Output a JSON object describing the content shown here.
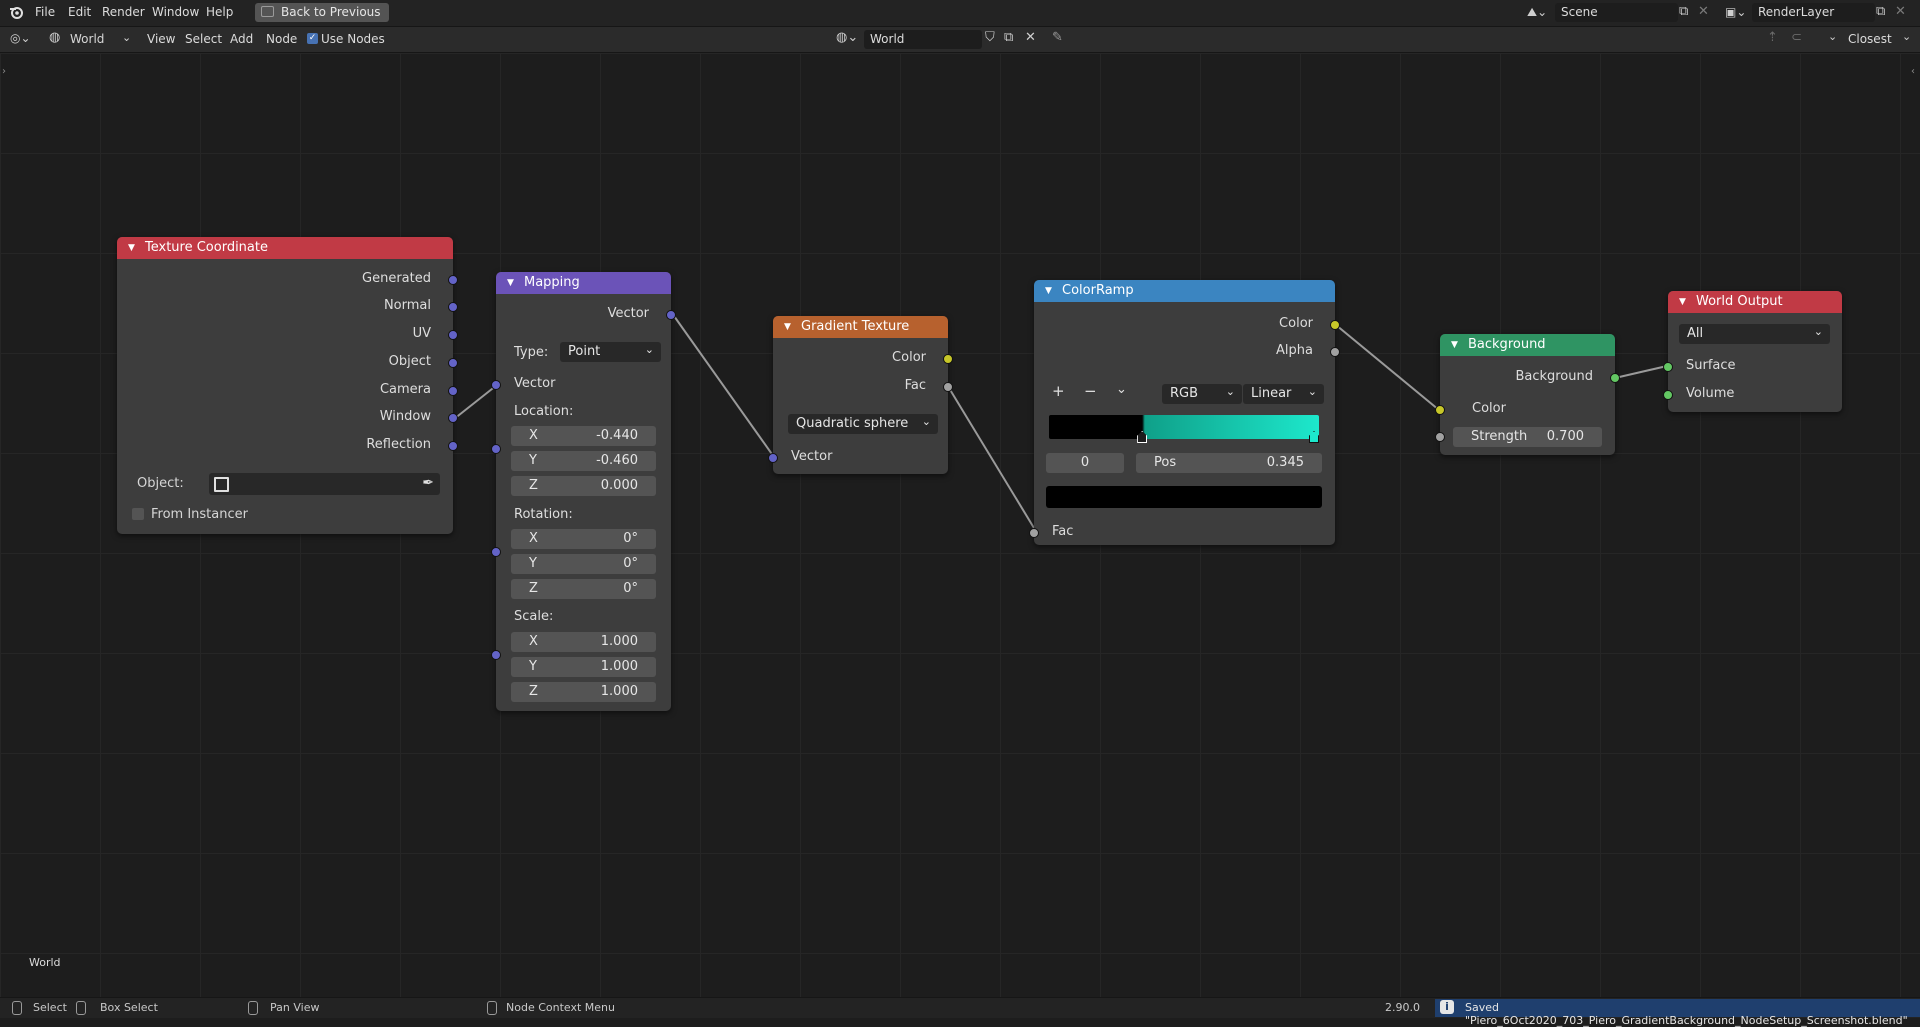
{
  "menubar": {
    "items": [
      "File",
      "Edit",
      "Render",
      "Window",
      "Help"
    ],
    "back_button": "Back to Previous",
    "scene": "Scene",
    "render_layer": "RenderLayer"
  },
  "header": {
    "world_selector": "World",
    "menus": [
      "View",
      "Select",
      "Add",
      "Node"
    ],
    "use_nodes_label": "Use Nodes",
    "use_nodes_checked": true,
    "world_name": "World",
    "snap_mode": "Closest"
  },
  "nodes": {
    "texture_coordinate": {
      "title": "Texture Coordinate",
      "outputs": [
        "Generated",
        "Normal",
        "UV",
        "Object",
        "Camera",
        "Window",
        "Reflection"
      ],
      "object_label": "Object:",
      "from_instancer": "From Instancer"
    },
    "mapping": {
      "title": "Mapping",
      "output": "Vector",
      "type_label": "Type:",
      "type_value": "Point",
      "input_vector": "Vector",
      "location_label": "Location:",
      "location": [
        {
          "k": "X",
          "v": "-0.440"
        },
        {
          "k": "Y",
          "v": "-0.460"
        },
        {
          "k": "Z",
          "v": "0.000"
        }
      ],
      "rotation_label": "Rotation:",
      "rotation": [
        {
          "k": "X",
          "v": "0°"
        },
        {
          "k": "Y",
          "v": "0°"
        },
        {
          "k": "Z",
          "v": "0°"
        }
      ],
      "scale_label": "Scale:",
      "scale": [
        {
          "k": "X",
          "v": "1.000"
        },
        {
          "k": "Y",
          "v": "1.000"
        },
        {
          "k": "Z",
          "v": "1.000"
        }
      ]
    },
    "gradient_texture": {
      "title": "Gradient Texture",
      "outputs": [
        "Color",
        "Fac"
      ],
      "type_value": "Quadratic sphere",
      "input_vector": "Vector"
    },
    "color_ramp": {
      "title": "ColorRamp",
      "outputs": [
        "Color",
        "Alpha"
      ],
      "color_mode": "RGB",
      "interpolation": "Linear",
      "active_index": "0",
      "pos_label": "Pos",
      "pos_value": "0.345",
      "input_fac": "Fac",
      "stop_positions": [
        0.345,
        1.0
      ],
      "ramp_colors": [
        "#000000",
        "#0fa089",
        "#1de8cc"
      ]
    },
    "background": {
      "title": "Background",
      "output": "Background",
      "input_color": "Color",
      "strength_label": "Strength",
      "strength_value": "0.700"
    },
    "world_output": {
      "title": "World Output",
      "target": "All",
      "inputs": [
        "Surface",
        "Volume"
      ]
    }
  },
  "canvas_label": "World",
  "statusbar": {
    "select": "Select",
    "box_select": "Box Select",
    "pan_view": "Pan View",
    "context_menu": "Node Context Menu",
    "version": "2.90.0",
    "message": "Saved \"Piero_6Oct2020_703_Piero_GradientBackground_NodeSetup_Screenshot.blend\""
  },
  "colors": {
    "texture_header": "#c13a45",
    "mapping_header": "#6b53b8",
    "gradient_header": "#b7612e",
    "colorramp_header": "#3b85c1",
    "background_header": "#2f9463",
    "output_header": "#c13a45"
  }
}
